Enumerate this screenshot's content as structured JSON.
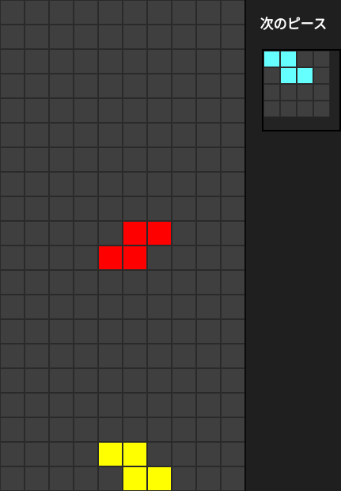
{
  "board": {
    "cols": 10,
    "rows": 20,
    "empty_color": "#3f3f3f",
    "grid_line_color": "#2a2a2a",
    "filled_cells": [
      {
        "col": 5,
        "row": 9,
        "color": "#ff0000",
        "piece": "S"
      },
      {
        "col": 6,
        "row": 9,
        "color": "#ff0000",
        "piece": "S"
      },
      {
        "col": 4,
        "row": 10,
        "color": "#ff0000",
        "piece": "S"
      },
      {
        "col": 5,
        "row": 10,
        "color": "#ff0000",
        "piece": "S"
      },
      {
        "col": 4,
        "row": 18,
        "color": "#ffff00",
        "piece": "Z"
      },
      {
        "col": 5,
        "row": 18,
        "color": "#ffff00",
        "piece": "Z"
      },
      {
        "col": 5,
        "row": 19,
        "color": "#ffff00",
        "piece": "Z"
      },
      {
        "col": 6,
        "row": 19,
        "color": "#ffff00",
        "piece": "Z"
      }
    ]
  },
  "side_panel": {
    "next_label": "次のピース"
  },
  "next_piece": {
    "cols": 4,
    "rows": 4,
    "shape": "Z",
    "filled_cells": [
      {
        "col": 0,
        "row": 0,
        "color": "#66ffff"
      },
      {
        "col": 1,
        "row": 0,
        "color": "#66ffff"
      },
      {
        "col": 1,
        "row": 1,
        "color": "#66ffff"
      },
      {
        "col": 2,
        "row": 1,
        "color": "#66ffff"
      }
    ]
  }
}
